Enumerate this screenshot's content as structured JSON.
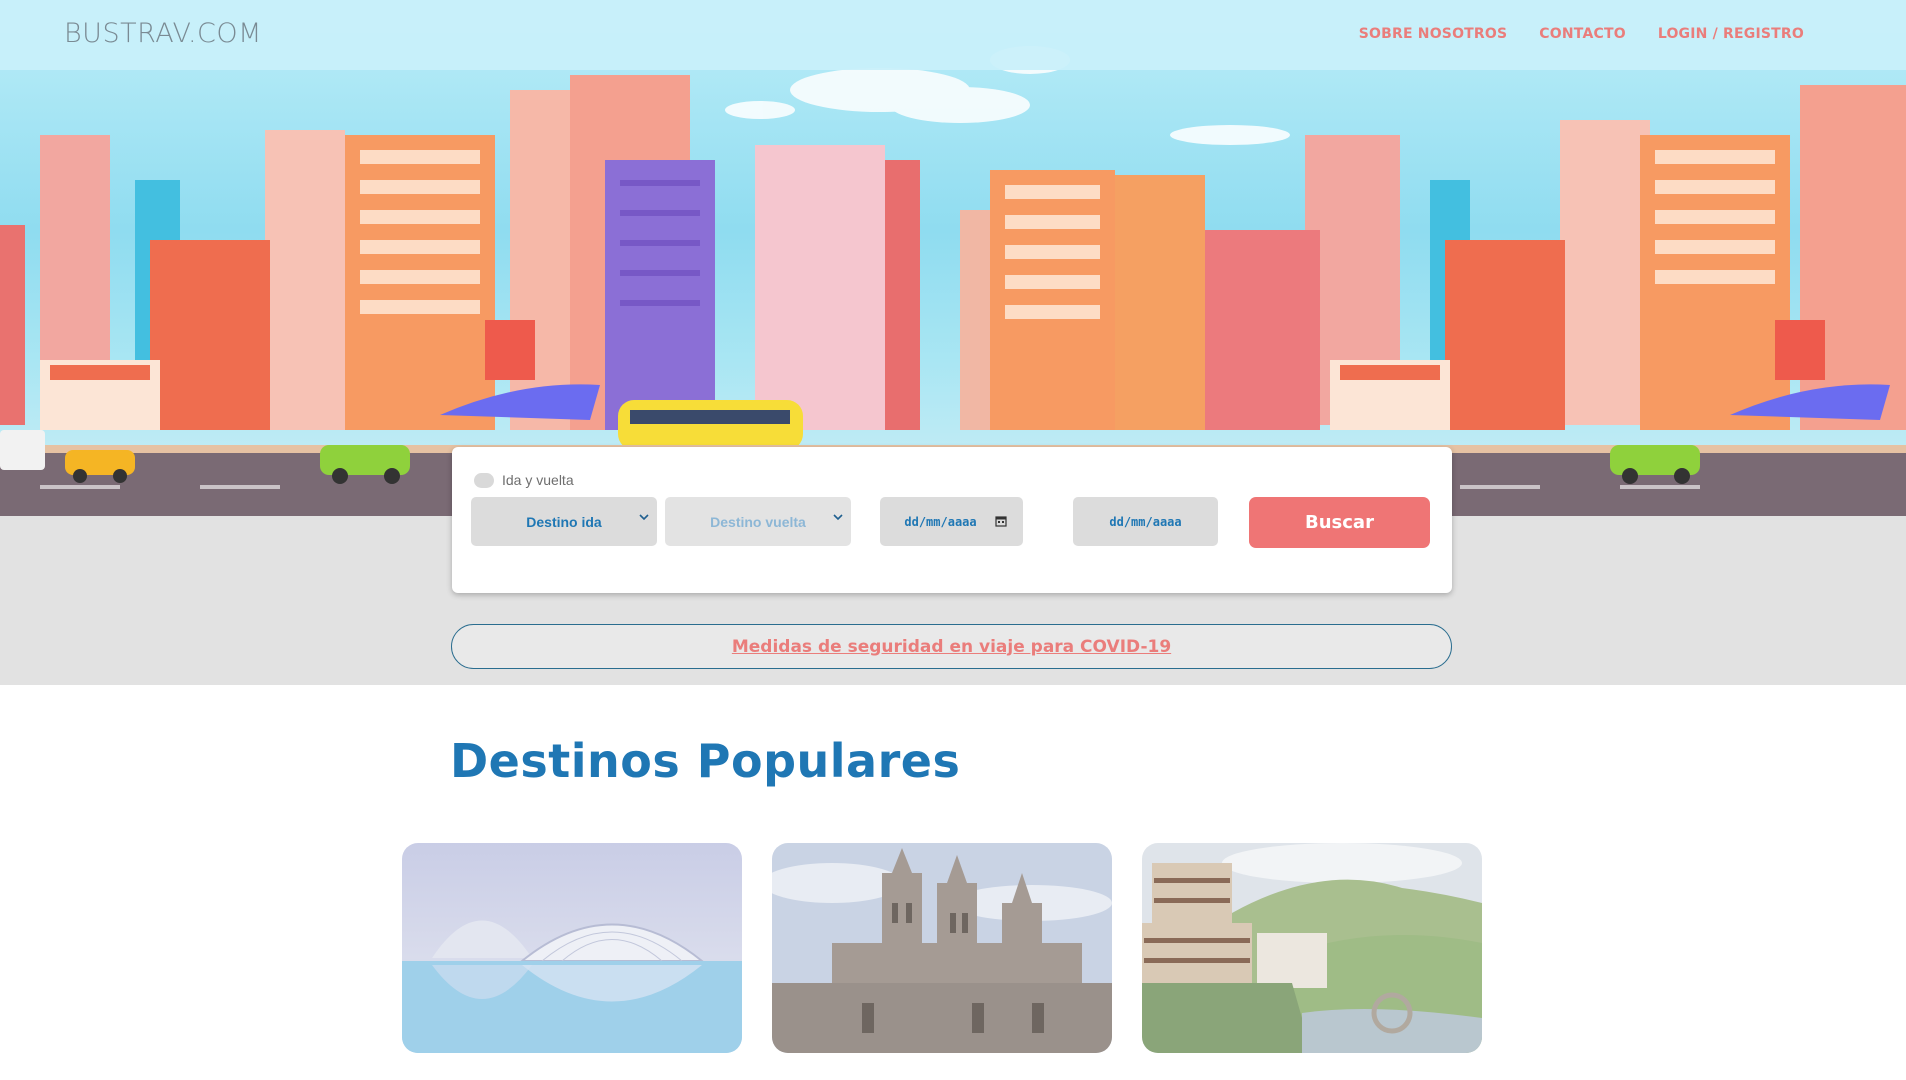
{
  "header": {
    "logo": "BUSTRAV.COM",
    "nav": [
      {
        "label": "SOBRE NOSOTROS"
      },
      {
        "label": "CONTACTO"
      },
      {
        "label": "LOGIN / REGISTRO"
      }
    ]
  },
  "search": {
    "roundtrip_label": "Ida y vuelta",
    "origin_select": "Destino ida",
    "return_select": "Destino vuelta",
    "date_ida_placeholder": "dd/mm/aaaa",
    "date_vuelta_placeholder": "dd/mm/aaaa",
    "search_button": "Buscar"
  },
  "covid_link": "Medidas de seguridad en viaje para COVID-19",
  "destinations": {
    "title": "Destinos Populares",
    "cards": [
      {
        "icon": "valencia-arts-sciences-image"
      },
      {
        "icon": "burgos-cathedral-image"
      },
      {
        "icon": "mountain-village-image"
      }
    ]
  },
  "colors": {
    "accent": "#ea7d7b",
    "button": "#ef7575",
    "primary_blue": "#1f77b4",
    "band_grey": "#e2e2e2"
  }
}
